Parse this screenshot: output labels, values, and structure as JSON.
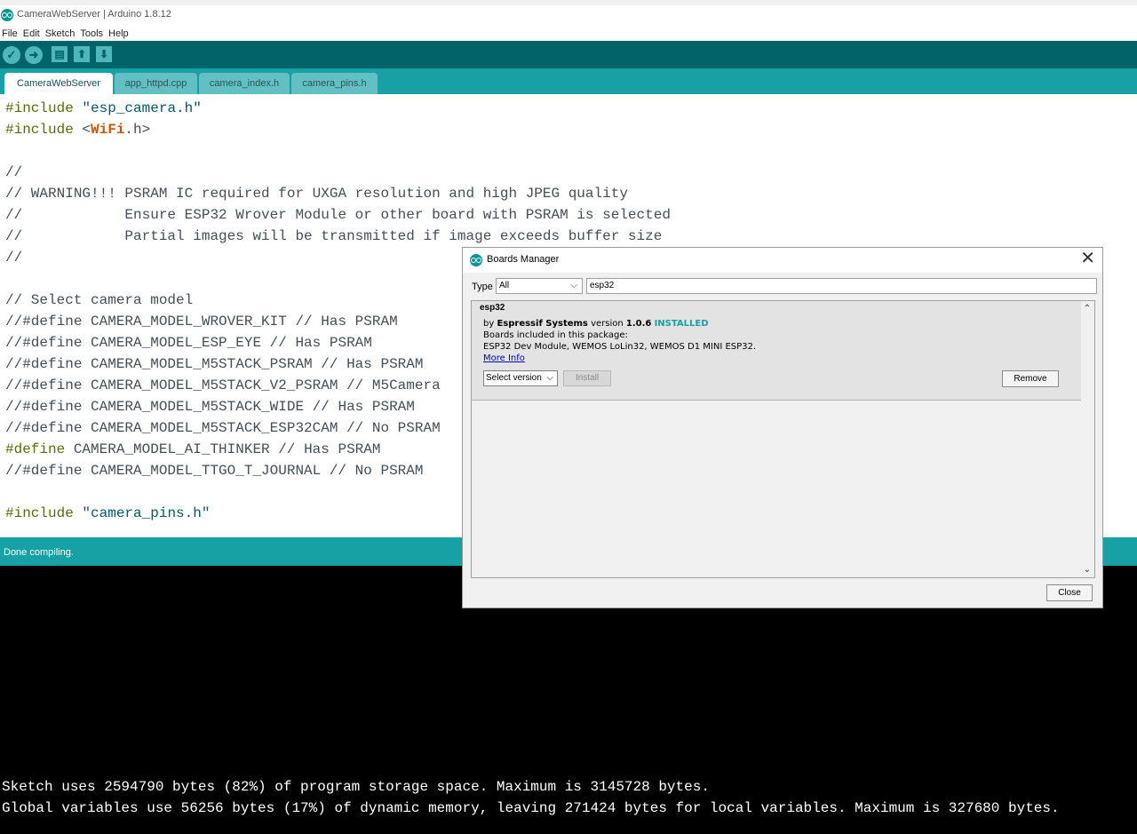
{
  "window": {
    "title": "CameraWebServer | Arduino 1.8.12"
  },
  "menu": [
    "File",
    "Edit",
    "Sketch",
    "Tools",
    "Help"
  ],
  "toolbar": {
    "verify_icon": "checkmark-icon",
    "upload_icon": "arrow-right-icon",
    "new_icon": "new-file-icon",
    "open_icon": "arrow-up-icon",
    "save_icon": "arrow-down-icon"
  },
  "tabs": [
    {
      "label": "CameraWebServer §"
    },
    {
      "label": "app_httpd.cpp"
    },
    {
      "label": "camera_index.h"
    },
    {
      "label": "camera_pins.h"
    }
  ],
  "code": [
    {
      "kw": "#include",
      "rest": " ",
      "str": "\"esp_camera.h\""
    },
    {
      "kw": "#include",
      "rest": " <",
      "lib": "WiFi",
      "tail": ".h>"
    },
    {
      "text": ""
    },
    {
      "text": "//"
    },
    {
      "text": "// WARNING!!! PSRAM IC required for UXGA resolution and high JPEG quality"
    },
    {
      "text": "//            Ensure ESP32 Wrover Module or other board with PSRAM is selected"
    },
    {
      "text": "//            Partial images will be transmitted if image exceeds buffer size"
    },
    {
      "text": "//"
    },
    {
      "text": ""
    },
    {
      "text": "// Select camera model"
    },
    {
      "text": "//#define CAMERA_MODEL_WROVER_KIT // Has PSRAM"
    },
    {
      "text": "//#define CAMERA_MODEL_ESP_EYE // Has PSRAM"
    },
    {
      "text": "//#define CAMERA_MODEL_M5STACK_PSRAM // Has PSRAM"
    },
    {
      "text": "//#define CAMERA_MODEL_M5STACK_V2_PSRAM // M5Camera"
    },
    {
      "text": "//#define CAMERA_MODEL_M5STACK_WIDE // Has PSRAM"
    },
    {
      "text": "//#define CAMERA_MODEL_M5STACK_ESP32CAM // No PSRAM"
    },
    {
      "kw": "#define",
      "rest": " CAMERA_MODEL_AI_THINKER // Has PSRAM"
    },
    {
      "text": "//#define CAMERA_MODEL_TTGO_T_JOURNAL // No PSRAM"
    },
    {
      "text": ""
    },
    {
      "kw": "#include",
      "rest": " ",
      "str": "\"camera_pins.h\""
    }
  ],
  "status": {
    "message": "Done compiling."
  },
  "console": [
    "Sketch uses 2594790 bytes (82%) of program storage space. Maximum is 3145728 bytes.",
    "Global variables use 56256 bytes (17%) of dynamic memory, leaving 271424 bytes for local variables. Maximum is 327680 bytes."
  ],
  "boards_manager": {
    "title": "Boards Manager",
    "close_glyph": "✕",
    "type_label": "Type",
    "type_value": "All",
    "search_value": "esp32",
    "entry": {
      "name": "esp32",
      "by_prefix": "by",
      "author": "Espressif Systems",
      "version_prefix": "version",
      "version": "1.0.6",
      "installed": "INSTALLED",
      "included_label": "Boards included in this package:",
      "boards": "ESP32 Dev Module, WEMOS LoLin32, WEMOS D1 MINI ESP32.",
      "more_info": "More Info",
      "select_version": "Select version",
      "install_label": "Install",
      "remove_label": "Remove"
    },
    "close_button": "Close"
  }
}
